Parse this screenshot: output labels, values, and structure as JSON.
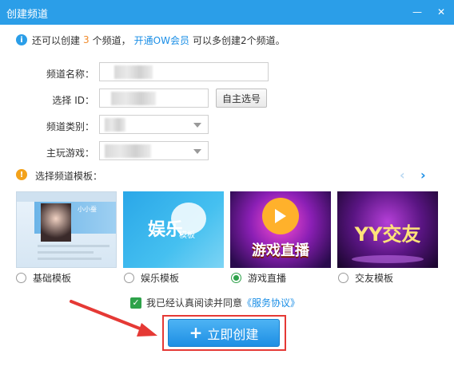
{
  "dialog": {
    "title": "创建频道",
    "minimize_glyph": "—",
    "close_glyph": "✕"
  },
  "info": {
    "icon": "i",
    "prefix": "还可以创建",
    "count": "3",
    "suffix": "个频道，",
    "vip_link": "开通OW会员",
    "tail": "可以多创建2个频道。"
  },
  "form": {
    "name_label": "频道名称：",
    "id_label": "选择 ID：",
    "self_select_button": "自主选号",
    "category_label": "频道类别：",
    "game_label": "主玩游戏："
  },
  "templates": {
    "section_label": "选择频道模板：",
    "warn_icon": "!",
    "prev_glyph": "‹",
    "next_glyph": "›",
    "items": [
      {
        "label": "基础模板",
        "thumb_text": "小小蚕",
        "selected": false
      },
      {
        "label": "娱乐模板",
        "thumb_text": "娱乐",
        "thumb_sub": "模板",
        "selected": false
      },
      {
        "label": "游戏直播",
        "thumb_text": "游戏直播",
        "selected": true
      },
      {
        "label": "交友模板",
        "thumb_text": "YY交友",
        "selected": false
      }
    ]
  },
  "agreement": {
    "prefix": "我已经认真阅读并同意",
    "link": "《服务协议》"
  },
  "create_button": {
    "plus": "+",
    "label": "立即创建"
  },
  "colors": {
    "accent": "#2b9ee8",
    "link": "#1a8ee6",
    "count": "#f08a2b",
    "check": "#2ea24a",
    "highlight": "#e53935"
  }
}
